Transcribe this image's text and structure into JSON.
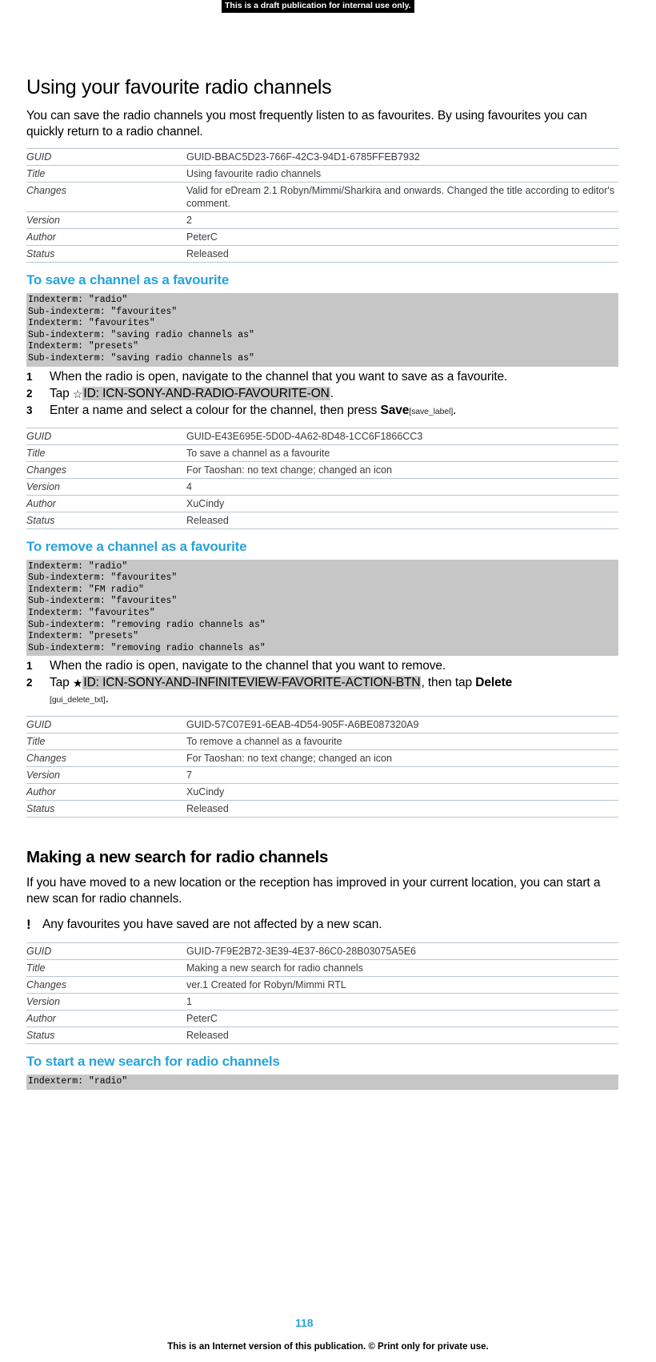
{
  "draft_banner": "This is a draft publication for internal use only.",
  "page_number": "118",
  "footer": "This is an Internet version of this publication. © Print only for private use.",
  "meta_keys": {
    "guid": "GUID",
    "title": "Title",
    "changes": "Changes",
    "version": "Version",
    "author": "Author",
    "status": "Status"
  },
  "sections": {
    "favourites": {
      "heading": "Using your favourite radio channels",
      "intro": "You can save the radio channels you most frequently listen to as favourites. By using favourites you can quickly return to a radio channel.",
      "meta": {
        "guid": "GUID-BBAC5D23-766F-42C3-94D1-6785FFEB7932",
        "title": "Using favourite radio channels",
        "changes": "Valid for eDream 2.1 Robyn/Mimmi/Sharkira and onwards. Changed the title according to editor's comment.",
        "version": "2",
        "author": "PeterC",
        "status": "Released"
      }
    },
    "save_channel": {
      "heading": "To save a channel as a favourite",
      "indexterms": "Indexterm: \"radio\"\nSub-indexterm: \"favourites\"\nIndexterm: \"favourites\"\nSub-indexterm: \"saving radio channels as\"\nIndexterm: \"presets\"\nSub-indexterm: \"saving radio channels as\"",
      "steps": [
        {
          "num": "1",
          "text": "When the radio is open, navigate to the channel that you want to save as a favourite."
        },
        {
          "num": "2",
          "prefix": "Tap ",
          "icon": "star-outline-icon",
          "token": "ID: ICN-SONY-AND-RADIO-FAVOURITE-ON",
          "suffix": "."
        },
        {
          "num": "3",
          "prefix": "Enter a name and select a colour for the channel, then press ",
          "bold": "Save",
          "tiny": "[save_label]",
          "suffix": "."
        }
      ],
      "meta": {
        "guid": "GUID-E43E695E-5D0D-4A62-8D48-1CC6F1866CC3",
        "title": "To save a channel as a favourite",
        "changes": "For Taoshan: no text change; changed an icon",
        "version": "4",
        "author": "XuCindy",
        "status": "Released"
      }
    },
    "remove_channel": {
      "heading": "To remove a channel as a favourite",
      "indexterms": "Indexterm: \"radio\"\nSub-indexterm: \"favourites\"\nIndexterm: \"FM radio\"\nSub-indexterm: \"favourites\"\nIndexterm: \"favourites\"\nSub-indexterm: \"removing radio channels as\"\nIndexterm: \"presets\"\nSub-indexterm: \"removing radio channels as\"",
      "steps": [
        {
          "num": "1",
          "text": "When the radio is open, navigate to the channel that you want to remove."
        },
        {
          "num": "2",
          "prefix": "Tap ",
          "icon": "star-solid-icon",
          "token": "ID: ICN-SONY-AND-INFINITEVIEW-FAVORITE-ACTION-BTN",
          "mid": ", then tap ",
          "bold": "Delete",
          "tiny": "[gui_delete_txt]",
          "suffix": "."
        }
      ],
      "meta": {
        "guid": "GUID-57C07E91-6EAB-4D54-905F-A6BE087320A9",
        "title": "To remove a channel as a favourite",
        "changes": "For Taoshan: no text change; changed an icon",
        "version": "7",
        "author": "XuCindy",
        "status": "Released"
      }
    },
    "new_search": {
      "heading": "Making a new search for radio channels",
      "intro": "If you have moved to a new location or the reception has improved in your current location, you can start a new scan for radio channels.",
      "note_icon": "exclamation-icon",
      "note": "Any favourites you have saved are not affected by a new scan.",
      "meta": {
        "guid": "GUID-7F9E2B72-3E39-4E37-86C0-28B03075A5E6",
        "title": "Making a new search for radio channels",
        "changes": "ver.1 Created for Robyn/Mimmi RTL",
        "version": "1",
        "author": "PeterC",
        "status": "Released"
      }
    },
    "start_search": {
      "heading": "To start a new search for radio channels",
      "indexterms": "Indexterm: \"radio\""
    }
  }
}
